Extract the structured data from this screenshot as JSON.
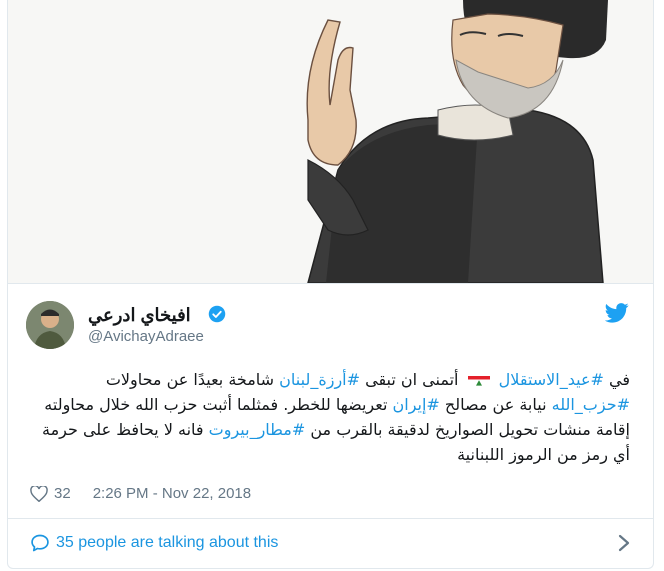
{
  "tweet": {
    "author": {
      "name": "افيخاي ادرعي",
      "handle": "@AvichayAdraee",
      "verified": true
    },
    "text_segments": [
      {
        "t": "في ",
        "tag": false
      },
      {
        "t": "#عيد_الاستقلال",
        "tag": true
      },
      {
        "t": " ",
        "tag": false,
        "flag": "lebanon-flag-emoji"
      },
      {
        "t": " أتمنى ان تبقى ",
        "tag": false
      },
      {
        "t": "#أرزة_لبنان",
        "tag": true
      },
      {
        "t": " شامخة بعيدًا عن محاولات ",
        "tag": false
      },
      {
        "t": "#حزب_الله",
        "tag": true
      },
      {
        "t": " نيابة عن مصالح ",
        "tag": false
      },
      {
        "t": "#إيران",
        "tag": true
      },
      {
        "t": " تعريضها للخطر. فمثلما أثبت حزب الله خلال محاولته إقامة منشات تحويل الصواريخ لدقيقة بالقرب من ",
        "tag": false
      },
      {
        "t": "#مطار_بيروت",
        "tag": true
      },
      {
        "t": " فانه لا يحافظ على حرمة أي رمز من الرموز اللبنانية",
        "tag": false
      }
    ],
    "likes": "32",
    "timestamp": "2:26 PM - Nov 22, 2018",
    "talking": "35 people are talking about this"
  },
  "icons": {
    "verified": "verified-badge-icon",
    "platform": "twitter-bird-icon",
    "like": "heart-icon",
    "reply": "speech-bubble-icon",
    "chevron": "chevron-right-icon"
  },
  "colors": {
    "link": "#1b95e0",
    "text": "#14171a",
    "muted": "#657786",
    "border": "#e1e8ed"
  }
}
